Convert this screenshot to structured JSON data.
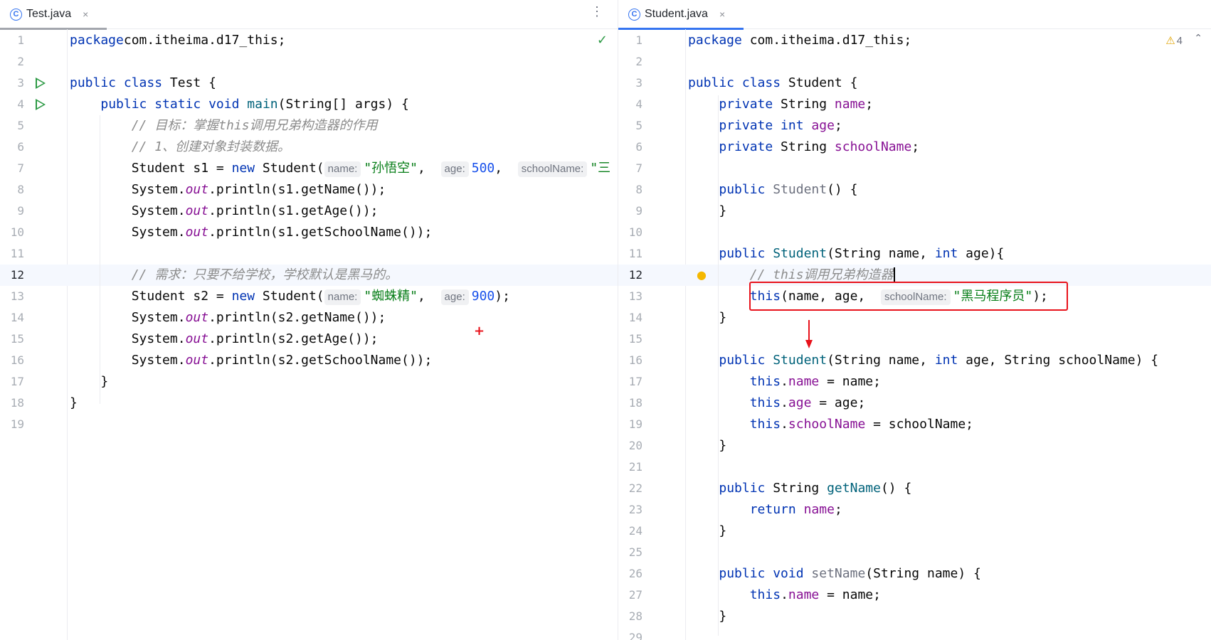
{
  "left_tab": {
    "icon": "class-icon",
    "icon_glyph": "C",
    "title": "Test.java",
    "close": "×"
  },
  "right_tab": {
    "icon": "class-icon",
    "icon_glyph": "C",
    "title": "Student.java",
    "close": "×"
  },
  "left_editor": {
    "inspection": "✓",
    "lines": [
      {
        "n": "1",
        "code": [
          [
            "kw",
            "package"
          ],
          [
            "",
            "com.itheima.d17_this;"
          ]
        ]
      },
      {
        "n": "2",
        "code": []
      },
      {
        "n": "3",
        "run": true,
        "code": [
          [
            "kw",
            "public class"
          ],
          [
            "",
            " Test {"
          ]
        ]
      },
      {
        "n": "4",
        "run": true,
        "code": [
          [
            "",
            "    "
          ],
          [
            "kw",
            "public static void"
          ],
          [
            "",
            " "
          ],
          [
            "mdecl",
            "main"
          ],
          [
            "",
            "(String[] args) {"
          ]
        ]
      },
      {
        "n": "5",
        "code": [
          [
            "",
            "        "
          ],
          [
            "com",
            "// 目标：掌握this调用兄弟构造器的作用"
          ]
        ]
      },
      {
        "n": "6",
        "code": [
          [
            "",
            "        "
          ],
          [
            "com",
            "// 1、创建对象封装数据。"
          ]
        ]
      },
      {
        "n": "7",
        "code": [
          [
            "",
            "        Student s1 = "
          ],
          [
            "kw",
            "new"
          ],
          [
            "",
            " Student("
          ],
          [
            "hint",
            "name:"
          ],
          [
            "str",
            "\"孙悟空\""
          ],
          [
            "",
            ",  "
          ],
          [
            "hint",
            "age:"
          ],
          [
            "num",
            "500"
          ],
          [
            "",
            ",  "
          ],
          [
            "hint",
            "schoolName:"
          ],
          [
            "str",
            "\"三"
          ]
        ]
      },
      {
        "n": "8",
        "code": [
          [
            "",
            "        System."
          ],
          [
            "sfld",
            "out"
          ],
          [
            "",
            ".println(s1.getName());"
          ]
        ]
      },
      {
        "n": "9",
        "code": [
          [
            "",
            "        System."
          ],
          [
            "sfld",
            "out"
          ],
          [
            "",
            ".println(s1.getAge());"
          ]
        ]
      },
      {
        "n": "10",
        "code": [
          [
            "",
            "        System."
          ],
          [
            "sfld",
            "out"
          ],
          [
            "",
            ".println(s1.getSchoolName());"
          ]
        ]
      },
      {
        "n": "11",
        "code": []
      },
      {
        "n": "12",
        "hl": true,
        "code": [
          [
            "",
            "        "
          ],
          [
            "com",
            "// 需求：只要不给学校，学校默认是黑马的。"
          ]
        ]
      },
      {
        "n": "13",
        "code": [
          [
            "",
            "        Student s2 = "
          ],
          [
            "kw",
            "new"
          ],
          [
            "",
            " Student("
          ],
          [
            "hint",
            "name:"
          ],
          [
            "str",
            "\"蜘蛛精\""
          ],
          [
            "",
            ",  "
          ],
          [
            "hint",
            "age:"
          ],
          [
            "num",
            "900"
          ],
          [
            "",
            ");"
          ]
        ]
      },
      {
        "n": "14",
        "code": [
          [
            "",
            "        System."
          ],
          [
            "sfld",
            "out"
          ],
          [
            "",
            ".println(s2.getName());"
          ]
        ]
      },
      {
        "n": "15",
        "code": [
          [
            "",
            "        System."
          ],
          [
            "sfld",
            "out"
          ],
          [
            "",
            ".println(s2.getAge());"
          ]
        ]
      },
      {
        "n": "16",
        "code": [
          [
            "",
            "        System."
          ],
          [
            "sfld",
            "out"
          ],
          [
            "",
            ".println(s2.getSchoolName());"
          ]
        ]
      },
      {
        "n": "17",
        "code": [
          [
            "",
            "    }"
          ]
        ]
      },
      {
        "n": "18",
        "code": [
          [
            "",
            "}"
          ]
        ]
      },
      {
        "n": "19",
        "code": []
      }
    ]
  },
  "right_editor": {
    "warnings": "4",
    "lines": [
      {
        "n": "1",
        "code": [
          [
            "kw",
            "package"
          ],
          [
            "",
            " com.itheima.d17_this;"
          ]
        ]
      },
      {
        "n": "2",
        "code": []
      },
      {
        "n": "3",
        "code": [
          [
            "kw",
            "public class"
          ],
          [
            "",
            " Student {"
          ]
        ]
      },
      {
        "n": "4",
        "code": [
          [
            "",
            "    "
          ],
          [
            "kw",
            "private"
          ],
          [
            "",
            " String "
          ],
          [
            "fld",
            "name"
          ],
          [
            "",
            ";"
          ]
        ]
      },
      {
        "n": "5",
        "code": [
          [
            "",
            "    "
          ],
          [
            "kw",
            "private int"
          ],
          [
            "",
            " "
          ],
          [
            "fld",
            "age"
          ],
          [
            "",
            ";"
          ]
        ]
      },
      {
        "n": "6",
        "code": [
          [
            "",
            "    "
          ],
          [
            "kw",
            "private"
          ],
          [
            "",
            " String "
          ],
          [
            "fld",
            "schoolName"
          ],
          [
            "",
            ";"
          ]
        ]
      },
      {
        "n": "7",
        "code": []
      },
      {
        "n": "8",
        "code": [
          [
            "",
            "    "
          ],
          [
            "kw",
            "public"
          ],
          [
            "",
            " "
          ],
          [
            "unused",
            "Student"
          ],
          [
            "",
            "() {"
          ]
        ]
      },
      {
        "n": "9",
        "code": [
          [
            "",
            "    }"
          ]
        ]
      },
      {
        "n": "10",
        "code": []
      },
      {
        "n": "11",
        "code": [
          [
            "",
            "    "
          ],
          [
            "kw",
            "public"
          ],
          [
            "",
            " "
          ],
          [
            "mdecl",
            "Student"
          ],
          [
            "",
            "(String name, "
          ],
          [
            "kw",
            "int"
          ],
          [
            "",
            " age){"
          ]
        ]
      },
      {
        "n": "12",
        "hl": true,
        "bulb": true,
        "code": [
          [
            "",
            "        "
          ],
          [
            "com",
            "// this调用兄弟构造器"
          ],
          [
            "caret",
            ""
          ]
        ]
      },
      {
        "n": "13",
        "code": [
          [
            "",
            "        "
          ],
          [
            "kw",
            "this"
          ],
          [
            "",
            "(name, age,  "
          ],
          [
            "hint",
            "schoolName:"
          ],
          [
            "str",
            "\"黑马程序员\""
          ],
          [
            "",
            ");"
          ]
        ]
      },
      {
        "n": "14",
        "code": [
          [
            "",
            "    }"
          ]
        ]
      },
      {
        "n": "15",
        "code": []
      },
      {
        "n": "16",
        "code": [
          [
            "",
            "    "
          ],
          [
            "kw",
            "public"
          ],
          [
            "",
            " "
          ],
          [
            "mdecl",
            "Student"
          ],
          [
            "",
            "(String name, "
          ],
          [
            "kw",
            "int"
          ],
          [
            "",
            " age, String schoolName) {"
          ]
        ]
      },
      {
        "n": "17",
        "code": [
          [
            "",
            "        "
          ],
          [
            "kw",
            "this"
          ],
          [
            "",
            "."
          ],
          [
            "fld",
            "name"
          ],
          [
            "",
            " = name;"
          ]
        ]
      },
      {
        "n": "18",
        "code": [
          [
            "",
            "        "
          ],
          [
            "kw",
            "this"
          ],
          [
            "",
            "."
          ],
          [
            "fld",
            "age"
          ],
          [
            "",
            " = age;"
          ]
        ]
      },
      {
        "n": "19",
        "code": [
          [
            "",
            "        "
          ],
          [
            "kw",
            "this"
          ],
          [
            "",
            "."
          ],
          [
            "fld",
            "schoolName"
          ],
          [
            "",
            " = schoolName;"
          ]
        ]
      },
      {
        "n": "20",
        "code": [
          [
            "",
            "    }"
          ]
        ]
      },
      {
        "n": "21",
        "code": []
      },
      {
        "n": "22",
        "code": [
          [
            "",
            "    "
          ],
          [
            "kw",
            "public"
          ],
          [
            "",
            " String "
          ],
          [
            "mdecl",
            "getName"
          ],
          [
            "",
            "() {"
          ]
        ]
      },
      {
        "n": "23",
        "code": [
          [
            "",
            "        "
          ],
          [
            "kw",
            "return"
          ],
          [
            "",
            " "
          ],
          [
            "fld",
            "name"
          ],
          [
            "",
            ";"
          ]
        ]
      },
      {
        "n": "24",
        "code": [
          [
            "",
            "    }"
          ]
        ]
      },
      {
        "n": "25",
        "code": []
      },
      {
        "n": "26",
        "code": [
          [
            "",
            "    "
          ],
          [
            "kw",
            "public void"
          ],
          [
            "",
            " "
          ],
          [
            "unused",
            "setName"
          ],
          [
            "",
            "(String name) {"
          ]
        ]
      },
      {
        "n": "27",
        "code": [
          [
            "",
            "        "
          ],
          [
            "kw",
            "this"
          ],
          [
            "",
            "."
          ],
          [
            "fld",
            "name"
          ],
          [
            "",
            " = name;"
          ]
        ]
      },
      {
        "n": "28",
        "code": [
          [
            "",
            "    }"
          ]
        ]
      },
      {
        "n": "29",
        "code": []
      }
    ]
  },
  "colors": {
    "accent": "#3574f0",
    "annotation_red": "#e8121b",
    "run_green": "#2d9a45"
  }
}
